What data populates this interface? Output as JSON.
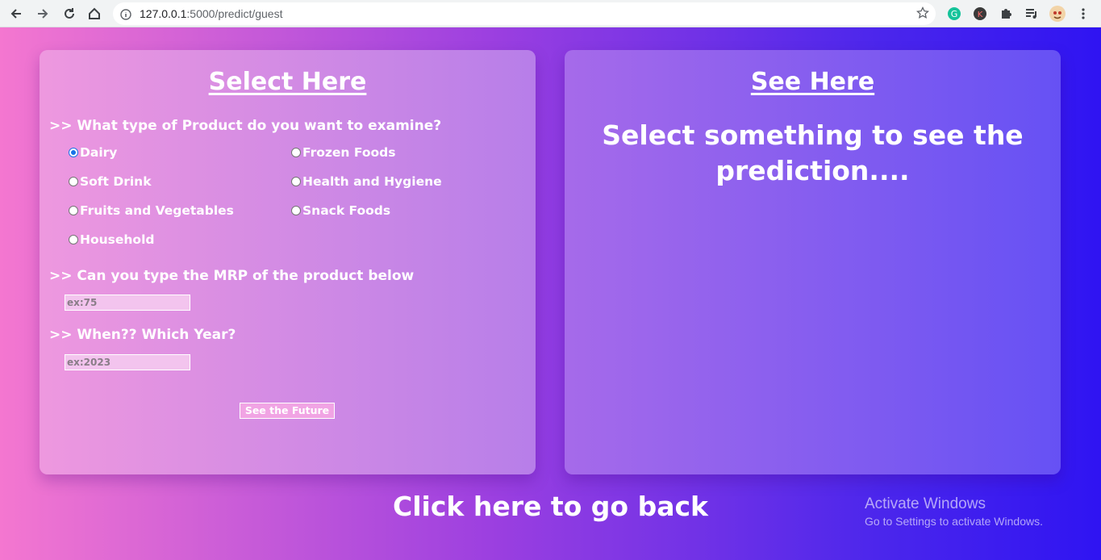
{
  "browser": {
    "url_host": "127.0.0.1",
    "url_rest": ":5000/predict/guest"
  },
  "left_card": {
    "title": "Select Here",
    "q1": ">> What type of Product do you want to examine?",
    "options": [
      {
        "label": "Dairy",
        "checked": true
      },
      {
        "label": "Frozen Foods",
        "checked": false
      },
      {
        "label": "Soft Drink",
        "checked": false
      },
      {
        "label": "Health and Hygiene",
        "checked": false
      },
      {
        "label": "Fruits and Vegetables",
        "checked": false
      },
      {
        "label": "Snack Foods",
        "checked": false
      },
      {
        "label": "Household",
        "checked": false
      }
    ],
    "q2": ">> Can you type the MRP of the product below",
    "mrp_placeholder": "ex:75",
    "mrp_value": "",
    "q3": ">> When?? Which Year?",
    "year_placeholder": "ex:2023",
    "year_value": "",
    "submit_label": "See the Future"
  },
  "right_card": {
    "title": "See Here",
    "message": "Select something to see the prediction...."
  },
  "back_link": "Click here to go back",
  "watermark": {
    "line1": "Activate Windows",
    "line2": "Go to Settings to activate Windows."
  }
}
